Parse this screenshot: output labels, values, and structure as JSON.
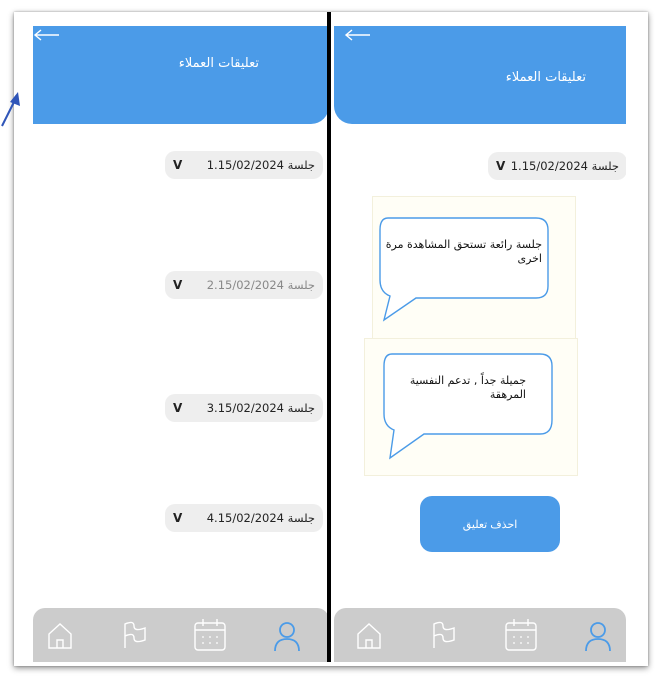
{
  "left_screen": {
    "title": "تعليقات العملاء",
    "sessions": [
      {
        "label": "1.جلسة 15/02/2024",
        "chevron": "V"
      },
      {
        "label": "2.جلسة 15/02/2024",
        "chevron": "V"
      },
      {
        "label": "3.جلسة 15/02/2024",
        "chevron": "V"
      },
      {
        "label": "4.جلسة 15/02/2024",
        "chevron": "V"
      }
    ]
  },
  "right_screen": {
    "title": "تعليقات العملاء",
    "session": {
      "label": "1.جلسة 15/02/2024",
      "chevron": "V"
    },
    "comments": [
      "جلسة رائعة تستحق المشاهدة مرة اخرى",
      "جميلة جداً , تدعم النفسية المرهقة"
    ],
    "delete_button": "احذف تعليق"
  },
  "nav": {
    "icons": [
      "home-icon",
      "flag-icon",
      "calendar-icon",
      "profile-icon"
    ]
  },
  "colors": {
    "header": "#4b9be8",
    "nav_bg": "#cccccc",
    "active_icon": "#4b9be8",
    "inactive_icon": "#ffffff",
    "session_bg": "#eeeeee"
  }
}
